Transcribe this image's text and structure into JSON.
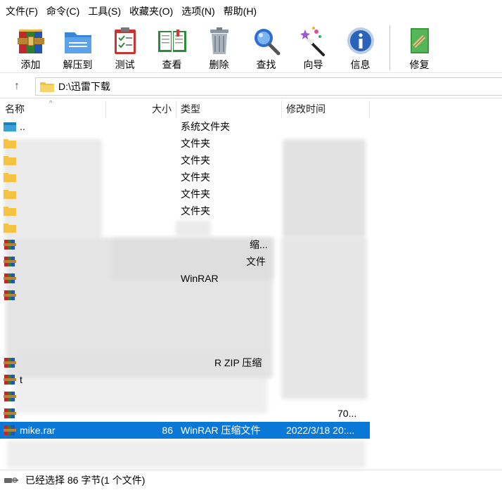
{
  "menu": [
    {
      "label": "文件(F)",
      "name": "menu-file"
    },
    {
      "label": "命令(C)",
      "name": "menu-command"
    },
    {
      "label": "工具(S)",
      "name": "menu-tools"
    },
    {
      "label": "收藏夹(O)",
      "name": "menu-favorites"
    },
    {
      "label": "选项(N)",
      "name": "menu-options"
    },
    {
      "label": "帮助(H)",
      "name": "menu-help"
    }
  ],
  "toolbar": {
    "add": "添加",
    "extract": "解压到",
    "test": "测试",
    "view": "查看",
    "delete": "删除",
    "find": "查找",
    "wizard": "向导",
    "info": "信息",
    "repair": "修复"
  },
  "address": {
    "path": "D:\\迅雷下载"
  },
  "columns": {
    "name": "名称",
    "size": "大小",
    "type": "类型",
    "modified": "修改时间"
  },
  "rows": {
    "parent": {
      "name": "..",
      "type": "系统文件夹"
    },
    "folder_type": "文件夹",
    "partial": {
      "r7_type": "缩...",
      "r8_type": "文件",
      "r9_type": "WinRAR",
      "r14_type": "R ZIP 压缩",
      "r15_name": "t",
      "r17_date": "70..."
    },
    "selected": {
      "name": "mike.rar",
      "size": "86",
      "type": "WinRAR 压缩文件",
      "date": "2022/3/18 20:..."
    }
  },
  "status": {
    "text": "已经选择 86 字节(1 个文件)"
  },
  "colors": {
    "selection": "#0a78d7",
    "folder": "#f5c242"
  }
}
